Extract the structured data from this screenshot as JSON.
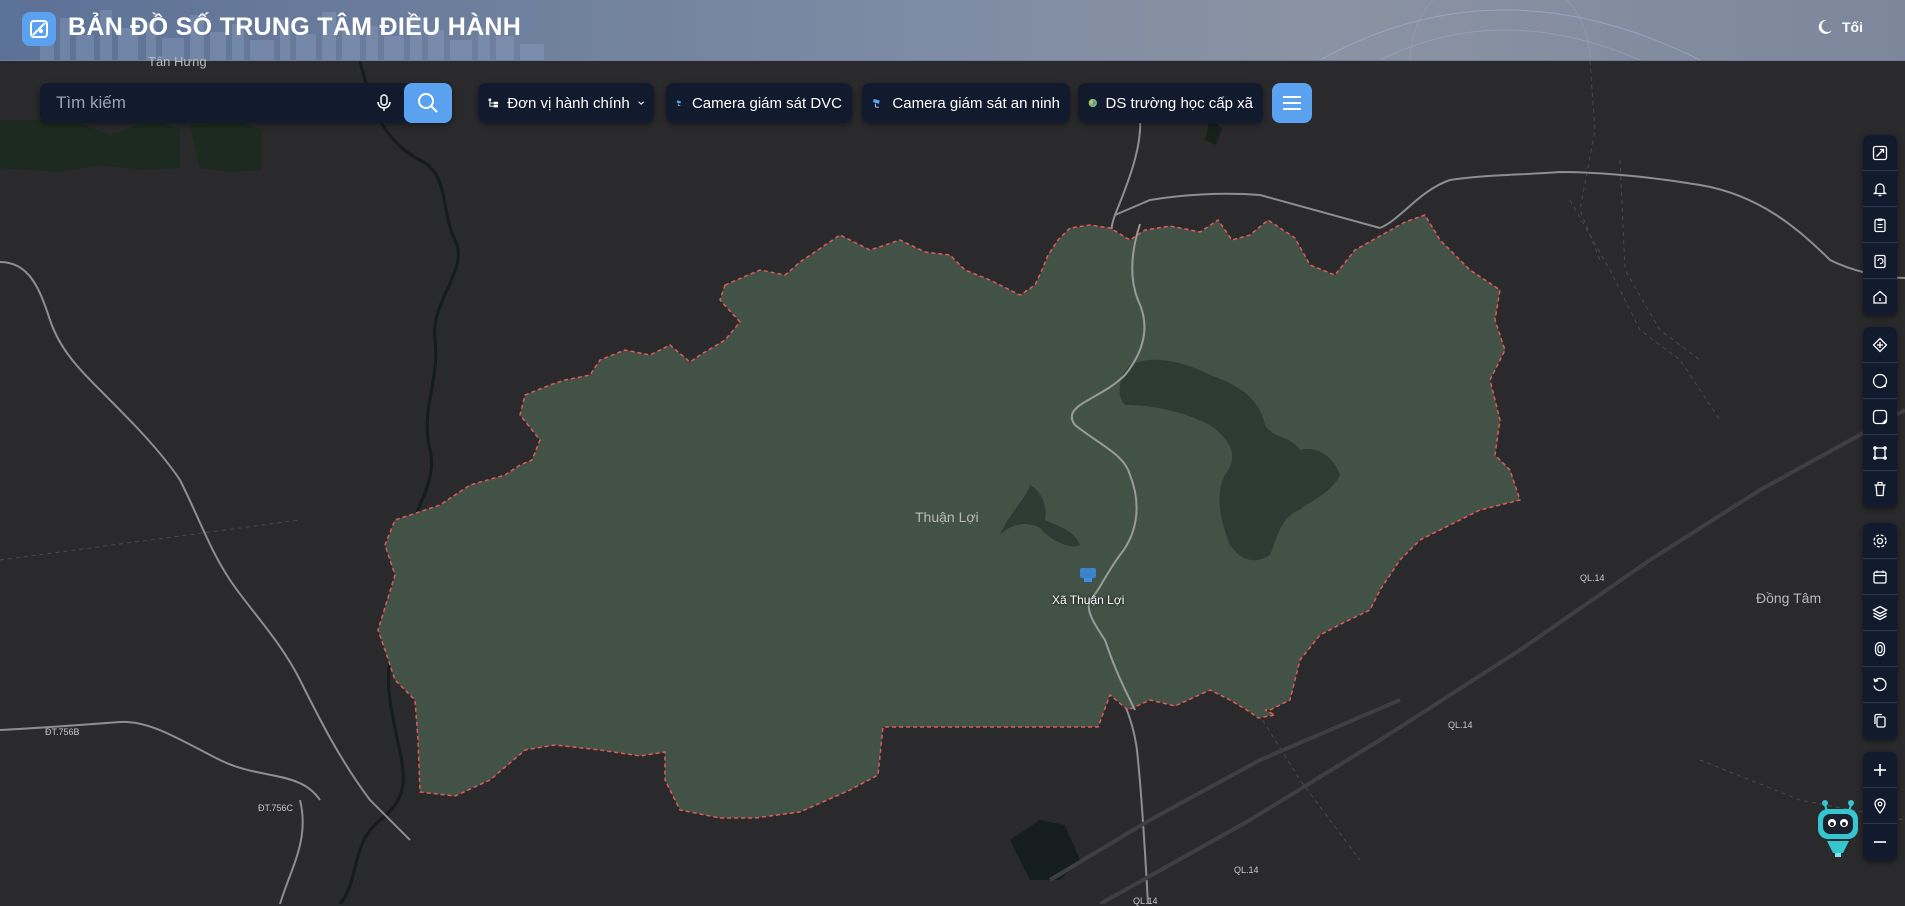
{
  "header": {
    "title": "BẢN ĐỒ SỐ TRUNG TÂM ĐIỀU HÀNH",
    "theme_label": "Tối"
  },
  "search": {
    "placeholder": "Tìm kiếm"
  },
  "filters": [
    {
      "label": "Đơn vị hành chính",
      "icon": "tree-icon"
    },
    {
      "label": "Camera giám sát DVC",
      "icon": "camera-icon"
    },
    {
      "label": "Camera giám sát an ninh",
      "icon": "camera-icon"
    },
    {
      "label": "DS trường học cấp xã",
      "icon": "school-icon"
    }
  ],
  "map": {
    "places": {
      "tan_hung": "Tân Hưng",
      "thuan_loi": "Thuận Lợi",
      "xa_thuan_loi": "Xã Thuận Lợi",
      "dong_tam": "Đồng Tâm"
    },
    "roads": {
      "ql14_a": "QL.14",
      "ql14_b": "QL.14",
      "ql14_c": "QL.14",
      "ql14_d": "QL.14",
      "dt756b": "ĐT.756B",
      "dt756c": "ĐT.756C"
    }
  },
  "colors": {
    "accent": "#5aa2f0",
    "panel": "#121a2e",
    "region_fill": "#435247",
    "region_border": "#e05a5a",
    "background": "#2a292b"
  },
  "tools": {
    "group1": [
      "expand-icon",
      "bell-icon",
      "clipboard-icon",
      "refresh-icon",
      "home-icon"
    ],
    "group2": [
      "navigate-icon",
      "circle-tool-icon",
      "square-tool-icon",
      "polygon-tool-icon",
      "trash-icon"
    ],
    "group3": [
      "settings-icon",
      "calendar-icon",
      "layers-icon",
      "fingerprint-icon",
      "rotate-icon",
      "copy-icon"
    ],
    "group4": [
      "zoom-in-icon",
      "location-pin-icon",
      "zoom-out-icon"
    ]
  }
}
